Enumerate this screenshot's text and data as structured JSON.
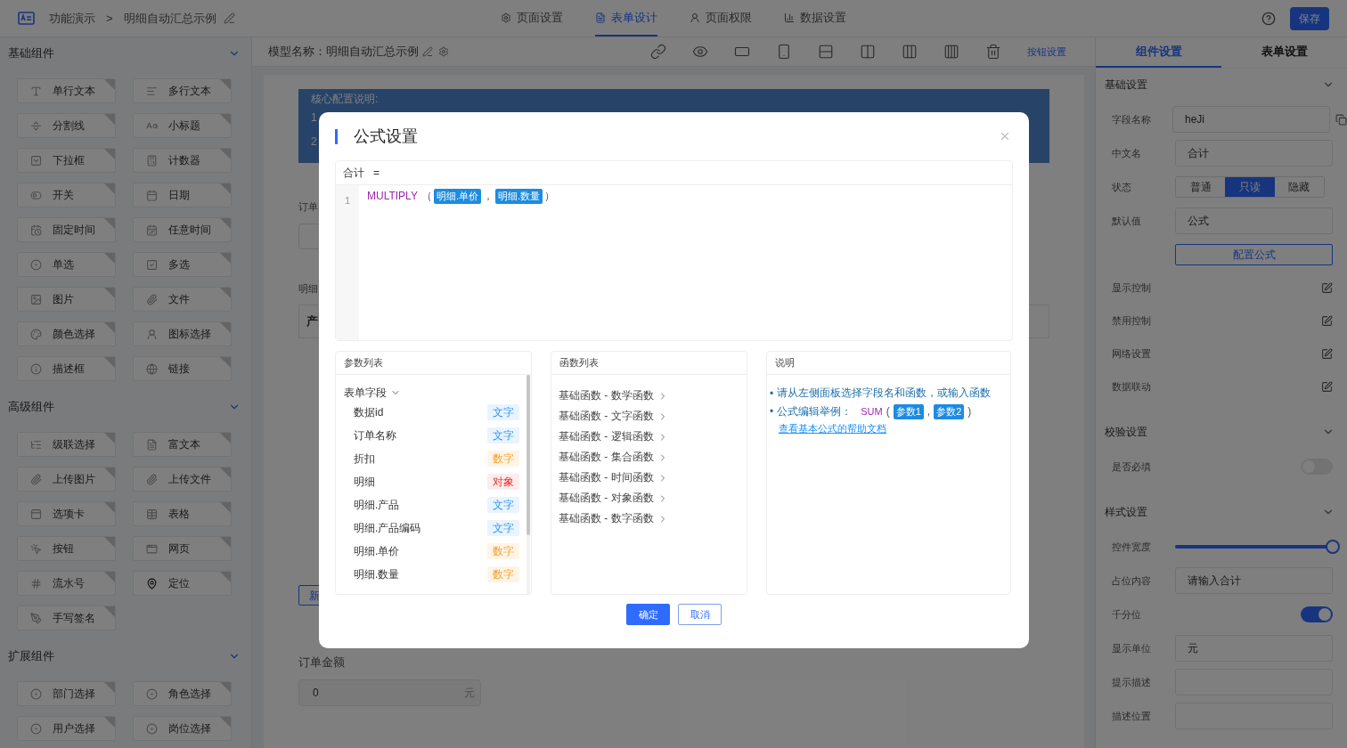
{
  "header": {
    "app_title": "功能演示",
    "separator": ">",
    "page_title": "明细自动汇总示例",
    "tabs": [
      {
        "label": "页面设置",
        "selected": false
      },
      {
        "label": "表单设计",
        "selected": true
      },
      {
        "label": "页面权限",
        "selected": false
      },
      {
        "label": "数据设置",
        "selected": false
      }
    ],
    "save_button": "保存"
  },
  "sidebar": {
    "sections": [
      {
        "title": "基础组件",
        "expanded": true,
        "items": [
          "单行文本",
          "多行文本",
          "分割线",
          "小标题",
          "下拉框",
          "计数器",
          "开关",
          "日期",
          "固定时间",
          "任意时间",
          "单选",
          "多选",
          "图片",
          "文件",
          "颜色选择",
          "图标选择",
          "描述框",
          "链接"
        ]
      },
      {
        "title": "高级组件",
        "expanded": true,
        "items": [
          "级联选择",
          "富文本",
          "上传图片",
          "上传文件",
          "选项卡",
          "表格",
          "按钮",
          "网页",
          "流水号",
          "定位",
          "手写签名"
        ]
      },
      {
        "title": "扩展组件",
        "expanded": true,
        "items": [
          "部门选择",
          "角色选择",
          "用户选择",
          "岗位选择"
        ]
      }
    ]
  },
  "toolbar": {
    "model_name": "模型名称：明细自动汇总示例",
    "button_settings": "按钮设置"
  },
  "canvas": {
    "notice": {
      "title": "核心配置说明:",
      "lines": [
        "1",
        "2"
      ]
    },
    "order_label": "订单",
    "detail_label": "明细",
    "table_header": "产",
    "add_button": "新",
    "amount_label": "订单金额",
    "amount_value": "0",
    "amount_unit": "元"
  },
  "right_panel": {
    "tabs": [
      {
        "label": "组件设置",
        "selected": true
      },
      {
        "label": "表单设置",
        "selected": false
      }
    ],
    "sections": [
      {
        "title": "基础设置",
        "expanded": true,
        "rows": [
          {
            "kind": "select",
            "label": "字段名称",
            "value": "heJi",
            "copyable": true
          },
          {
            "kind": "input",
            "label": "中文名",
            "value": "合计"
          },
          {
            "kind": "segmented",
            "label": "状态",
            "options": [
              {
                "label": "普通",
                "selected": false
              },
              {
                "label": "只读",
                "selected": true
              },
              {
                "label": "隐藏",
                "selected": false
              }
            ]
          },
          {
            "kind": "select",
            "label": "默认值",
            "value": "公式",
            "copyable": false
          },
          {
            "kind": "button",
            "label": "配置公式"
          },
          {
            "kind": "edit",
            "label": "显示控制"
          },
          {
            "kind": "edit",
            "label": "禁用控制"
          },
          {
            "kind": "edit",
            "label": "网络设置"
          },
          {
            "kind": "edit",
            "label": "数据联动"
          }
        ]
      },
      {
        "title": "校验设置",
        "expanded": true,
        "rows": [
          {
            "kind": "toggle",
            "label": "是否必填",
            "on": false
          }
        ]
      },
      {
        "title": "样式设置",
        "expanded": true,
        "rows": [
          {
            "kind": "slider",
            "label": "控件宽度",
            "level": 1
          },
          {
            "kind": "input",
            "label": "占位内容",
            "value": "请输入合计"
          },
          {
            "kind": "toggle",
            "label": "千分位",
            "on": true
          },
          {
            "kind": "input",
            "label": "显示单位",
            "value": "元"
          },
          {
            "kind": "input",
            "label": "提示描述"
          },
          {
            "kind": "input",
            "label": "描述位置"
          }
        ]
      }
    ]
  },
  "modal": {
    "title": "公式设置",
    "formula": {
      "target": "合计",
      "equals": "=",
      "line_number": "1",
      "function": "MULTIPLY",
      "open": "（",
      "args": [
        "明细.单价",
        "明细.数量"
      ],
      "separator": "，",
      "close": "）"
    },
    "params": {
      "title": "参数列表",
      "group": {
        "label": "表单字段",
        "expanded": true
      },
      "items": [
        {
          "name": "数据id",
          "type": "文字",
          "color": "#e8f4ff"
        },
        {
          "name": "订单名称",
          "type": "文字",
          "color": "#e8f4ff"
        },
        {
          "name": "折扣",
          "type": "数字",
          "color": "#fff4e5"
        },
        {
          "name": "明细",
          "type": "对象",
          "color": "#fdecec"
        },
        {
          "name": "明细.产品",
          "type": "文字",
          "color": "#e8f4ff"
        },
        {
          "name": "明细.产品编码",
          "type": "文字",
          "color": "#e8f4ff"
        },
        {
          "name": "明细.单价",
          "type": "数字",
          "color": "#fff4e5"
        },
        {
          "name": "明细.数量",
          "type": "数字",
          "color": "#fff4e5"
        }
      ]
    },
    "functions": {
      "title": "函数列表",
      "items": [
        "基础函数 - 数学函数",
        "基础函数 - 文字函数",
        "基础函数 - 逻辑函数",
        "基础函数 - 集合函数",
        "基础函数 - 时间函数",
        "基础函数 - 对象函数",
        "基础函数 - 数字函数"
      ]
    },
    "help": {
      "title": "说明",
      "bullet": "•",
      "tip": "请从左侧面板选择字段名和函数，或输入函数",
      "example": {
        "label": "公式编辑举例：",
        "function": "SUM",
        "open": "(",
        "args": [
          "参数1",
          "参数2"
        ],
        "separator": ",",
        "close": ")"
      },
      "link": "查看基本公式的帮助文档"
    },
    "confirm_button": "确定",
    "cancel_button": "取消"
  }
}
